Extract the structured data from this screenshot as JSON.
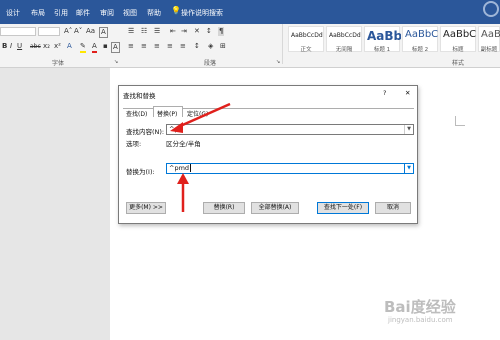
{
  "tabs": [
    "设计",
    "布局",
    "引用",
    "邮件",
    "审阅",
    "视图",
    "帮助"
  ],
  "tell_me": "操作说明搜索",
  "ribbon": {
    "font_group": "字体",
    "paragraph_group": "段落",
    "styles_group": "样式",
    "font_buttons": [
      "A˄",
      "A˅",
      "Aa",
      "A"
    ],
    "format_buttons": [
      "B",
      "I",
      "U",
      "abc",
      "x₂",
      "x²"
    ],
    "styles": [
      {
        "preview": "AaBbCcDd",
        "name": "正文"
      },
      {
        "preview": "AaBbCcDd",
        "name": "无间隔"
      },
      {
        "preview": "AaBb",
        "name": "标题 1"
      },
      {
        "preview": "AaBbC",
        "name": "标题 2"
      },
      {
        "preview": "AaBbC",
        "name": "标题"
      },
      {
        "preview": "AaBbC",
        "name": "副标题"
      }
    ]
  },
  "dialog": {
    "title": "查找和替换",
    "help": "?",
    "close": "✕",
    "tabs": [
      "查找(D)",
      "替换(P)",
      "定位(G)"
    ],
    "find_label": "查找内容(N):",
    "find_value": "^p",
    "options_label": "选项:",
    "options_value": "区分全/半角",
    "replace_label": "替换为(I):",
    "replace_value": "^pmd",
    "buttons": {
      "more": "更多(M) >>",
      "replace": "替换(R)",
      "replace_all": "全部替换(A)",
      "find_next": "查找下一处(F)",
      "cancel": "取消"
    }
  },
  "watermark": {
    "logo": "Bai度经验",
    "url": "jingyan.baidu.com"
  },
  "colors": {
    "ribbon_blue": "#2b579a",
    "arrow_red": "#e0201c",
    "accent_blue": "#0078d7"
  }
}
